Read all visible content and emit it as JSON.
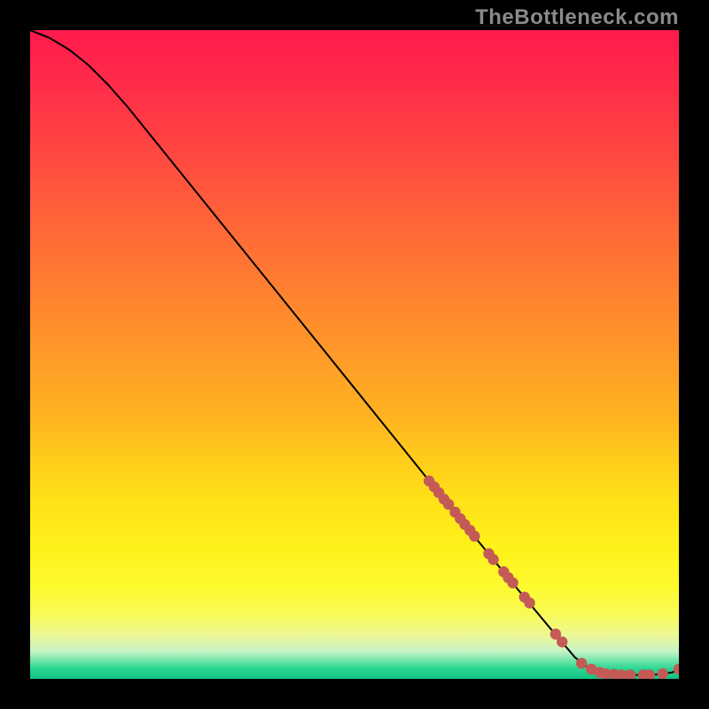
{
  "watermark": "TheBottleneck.com",
  "gradient": {
    "stops": [
      {
        "offset": 0.0,
        "color": "#ff1a4d"
      },
      {
        "offset": 0.1,
        "color": "#ff3048"
      },
      {
        "offset": 0.2,
        "color": "#ff4a40"
      },
      {
        "offset": 0.3,
        "color": "#ff6638"
      },
      {
        "offset": 0.4,
        "color": "#ff8030"
      },
      {
        "offset": 0.5,
        "color": "#ff9a28"
      },
      {
        "offset": 0.6,
        "color": "#ffb420"
      },
      {
        "offset": 0.65,
        "color": "#ffc81c"
      },
      {
        "offset": 0.72,
        "color": "#ffe018"
      },
      {
        "offset": 0.8,
        "color": "#fff21a"
      },
      {
        "offset": 0.86,
        "color": "#fdfa30"
      },
      {
        "offset": 0.9,
        "color": "#f8fb55"
      },
      {
        "offset": 0.93,
        "color": "#eff890"
      },
      {
        "offset": 0.958,
        "color": "#c6f3c6"
      },
      {
        "offset": 0.972,
        "color": "#6fe6a8"
      },
      {
        "offset": 0.985,
        "color": "#28d490"
      },
      {
        "offset": 1.0,
        "color": "#12c282"
      }
    ]
  },
  "marker_color": "#c45a56",
  "chart_data": {
    "type": "line",
    "title": "",
    "xlabel": "",
    "ylabel": "",
    "xlim": [
      0,
      100
    ],
    "ylim": [
      0,
      100
    ],
    "series": [
      {
        "name": "curve",
        "x": [
          0,
          3,
          6,
          9,
          12,
          15,
          20,
          25,
          30,
          35,
          40,
          45,
          50,
          55,
          60,
          65,
          70,
          75,
          80,
          84,
          86,
          87.5,
          89,
          91,
          93,
          95,
          97,
          99,
          100
        ],
        "y": [
          100,
          98.8,
          97.0,
          94.6,
          91.6,
          88.2,
          82.0,
          75.8,
          69.6,
          63.4,
          57.2,
          51.0,
          44.8,
          38.6,
          32.4,
          26.2,
          20.1,
          14.0,
          8.0,
          3.3,
          1.8,
          1.0,
          0.7,
          0.6,
          0.6,
          0.6,
          0.7,
          1.0,
          1.5
        ]
      }
    ],
    "scatter": {
      "name": "markers",
      "x": [
        61.5,
        62.3,
        63.0,
        63.8,
        64.5,
        65.5,
        66.3,
        67.0,
        67.8,
        68.5,
        70.7,
        71.4,
        73.0,
        73.7,
        74.4,
        76.2,
        77.0,
        81.0,
        82.0,
        85.0,
        86.5,
        87.8,
        88.7,
        90.0,
        91.2,
        92.5,
        94.5,
        95.5,
        97.5,
        100.0
      ],
      "y": [
        30.5,
        29.6,
        28.7,
        27.7,
        26.9,
        25.7,
        24.7,
        23.8,
        22.9,
        22.0,
        19.3,
        18.4,
        16.5,
        15.6,
        14.8,
        12.6,
        11.7,
        6.9,
        5.7,
        2.4,
        1.5,
        1.0,
        0.8,
        0.7,
        0.6,
        0.6,
        0.6,
        0.6,
        0.8,
        1.5
      ]
    }
  }
}
